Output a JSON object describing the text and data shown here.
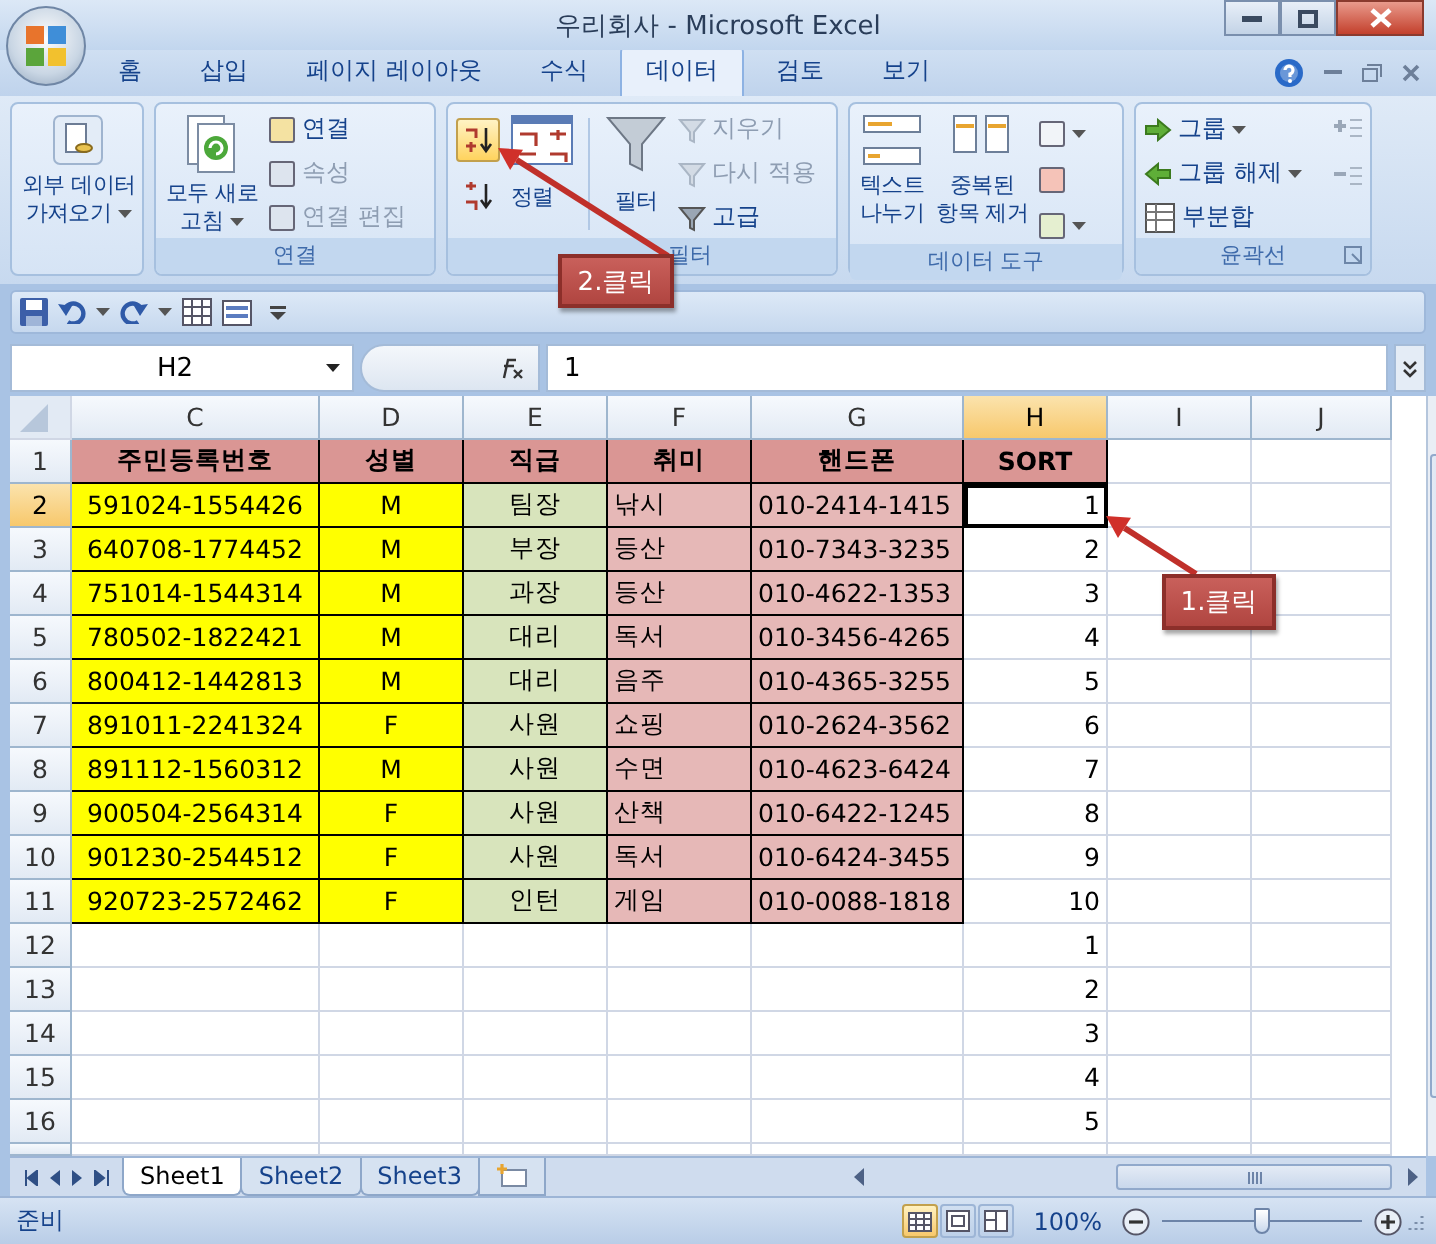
{
  "window": {
    "title": "우리회사 - Microsoft Excel"
  },
  "tabs": [
    {
      "label": "홈",
      "selected": false
    },
    {
      "label": "삽입",
      "selected": false
    },
    {
      "label": "페이지 레이아웃",
      "selected": false
    },
    {
      "label": "수식",
      "selected": false
    },
    {
      "label": "데이터",
      "selected": true
    },
    {
      "label": "검토",
      "selected": false
    },
    {
      "label": "보기",
      "selected": false
    }
  ],
  "ribbon": {
    "get_external": {
      "lines": [
        "외부 데이터",
        "가져오기"
      ]
    },
    "connections": {
      "title": "연결",
      "refresh": [
        "모두 새로",
        "고침"
      ],
      "items": [
        {
          "label": "연결",
          "disabled": false
        },
        {
          "label": "속성",
          "disabled": true
        },
        {
          "label": "연결 편집",
          "disabled": true
        }
      ]
    },
    "sort_filter": {
      "title": "필터",
      "sort": "정렬",
      "filter": "필터",
      "sort_asc_highlighted": true,
      "items": [
        {
          "label": "지우기",
          "disabled": true
        },
        {
          "label": "다시 적용",
          "disabled": true
        },
        {
          "label": "고급",
          "disabled": false
        }
      ]
    },
    "data_tools": {
      "title": "데이터 도구",
      "buttons": [
        [
          "텍스트",
          "나누기"
        ],
        [
          "중복된",
          "항목 제거"
        ]
      ]
    },
    "outline": {
      "title": "윤곽선",
      "items": [
        {
          "label": "그룹",
          "menu": true
        },
        {
          "label": "그룹 해제",
          "menu": true
        },
        {
          "label": "부분합",
          "menu": false
        }
      ]
    }
  },
  "formula_bar": {
    "name_box": "H2",
    "value": "1"
  },
  "grid": {
    "columns": [
      {
        "letter": "C",
        "selected": false
      },
      {
        "letter": "D",
        "selected": false
      },
      {
        "letter": "E",
        "selected": false
      },
      {
        "letter": "F",
        "selected": false
      },
      {
        "letter": "G",
        "selected": false
      },
      {
        "letter": "H",
        "selected": true
      },
      {
        "letter": "I",
        "selected": false
      },
      {
        "letter": "J",
        "selected": false
      }
    ],
    "rows": [
      {
        "number": "1",
        "kind": "header",
        "selected": false,
        "cells": {
          "c": "주민등록번호",
          "d": "성별",
          "e": "직급",
          "f": "취미",
          "g": "핸드폰",
          "h": "SORT"
        }
      },
      {
        "number": "2",
        "kind": "record",
        "selected": true,
        "cells": {
          "c": "591024-1554426",
          "d": "M",
          "e": "팀장",
          "f": "낚시",
          "g": "010-2414-1415",
          "h": "1"
        }
      },
      {
        "number": "3",
        "kind": "record",
        "selected": false,
        "cells": {
          "c": "640708-1774452",
          "d": "M",
          "e": "부장",
          "f": "등산",
          "g": "010-7343-3235",
          "h": "2"
        }
      },
      {
        "number": "4",
        "kind": "record",
        "selected": false,
        "cells": {
          "c": "751014-1544314",
          "d": "M",
          "e": "과장",
          "f": "등산",
          "g": "010-4622-1353",
          "h": "3"
        }
      },
      {
        "number": "5",
        "kind": "record",
        "selected": false,
        "cells": {
          "c": "780502-1822421",
          "d": "M",
          "e": "대리",
          "f": "독서",
          "g": "010-3456-4265",
          "h": "4"
        }
      },
      {
        "number": "6",
        "kind": "record",
        "selected": false,
        "cells": {
          "c": "800412-1442813",
          "d": "M",
          "e": "대리",
          "f": "음주",
          "g": "010-4365-3255",
          "h": "5"
        }
      },
      {
        "number": "7",
        "kind": "record",
        "selected": false,
        "cells": {
          "c": "891011-2241324",
          "d": "F",
          "e": "사원",
          "f": "쇼핑",
          "g": "010-2624-3562",
          "h": "6"
        }
      },
      {
        "number": "8",
        "kind": "record",
        "selected": false,
        "cells": {
          "c": "891112-1560312",
          "d": "M",
          "e": "사원",
          "f": "수면",
          "g": "010-4623-6424",
          "h": "7"
        }
      },
      {
        "number": "9",
        "kind": "record",
        "selected": false,
        "cells": {
          "c": "900504-2564314",
          "d": "F",
          "e": "사원",
          "f": "산책",
          "g": "010-6422-1245",
          "h": "8"
        }
      },
      {
        "number": "10",
        "kind": "record",
        "selected": false,
        "cells": {
          "c": "901230-2544512",
          "d": "F",
          "e": "사원",
          "f": "독서",
          "g": "010-6424-3455",
          "h": "9"
        }
      },
      {
        "number": "11",
        "kind": "record",
        "selected": false,
        "cells": {
          "c": "920723-2572462",
          "d": "F",
          "e": "인턴",
          "f": "게임",
          "g": "010-0088-1818",
          "h": "10"
        }
      },
      {
        "number": "12",
        "kind": "blank",
        "selected": false,
        "cells": {
          "h": "1"
        }
      },
      {
        "number": "13",
        "kind": "blank",
        "selected": false,
        "cells": {
          "h": "2"
        }
      },
      {
        "number": "14",
        "kind": "blank",
        "selected": false,
        "cells": {
          "h": "3"
        }
      },
      {
        "number": "15",
        "kind": "blank",
        "selected": false,
        "cells": {
          "h": "4"
        }
      },
      {
        "number": "16",
        "kind": "blank",
        "selected": false,
        "cells": {
          "h": "5"
        }
      }
    ]
  },
  "sheets": [
    {
      "label": "Sheet1",
      "selected": true
    },
    {
      "label": "Sheet2",
      "selected": false
    },
    {
      "label": "Sheet3",
      "selected": false
    }
  ],
  "status": {
    "text": "준비",
    "zoom": "100%",
    "level": 0.5,
    "views": [
      {
        "kind": "normal",
        "selected": true
      },
      {
        "kind": "layout",
        "selected": false
      },
      {
        "kind": "pagebreak",
        "selected": false
      }
    ]
  },
  "callouts": [
    {
      "label": "2.클릭"
    },
    {
      "label": "1.클릭"
    }
  ]
}
